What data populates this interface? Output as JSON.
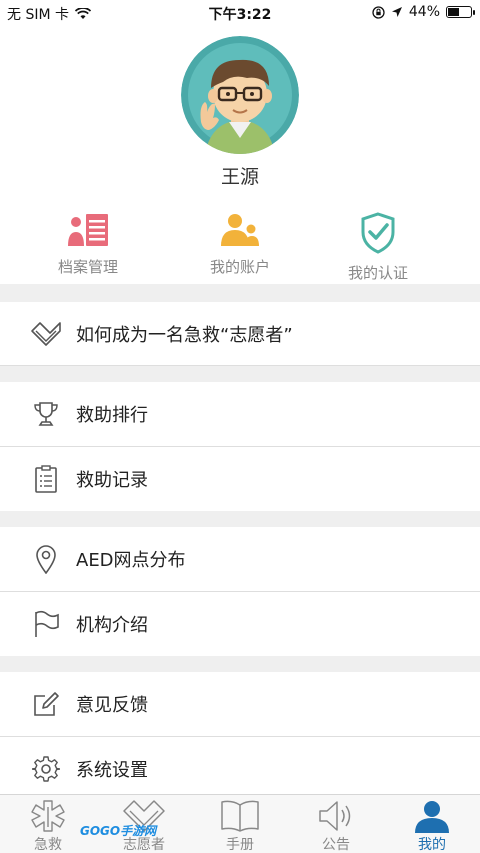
{
  "status": {
    "carrier": "无 SIM 卡",
    "time": "下午3:22",
    "battery_percent": "44%",
    "battery_level": 0.44
  },
  "profile": {
    "name": "王源"
  },
  "quick_actions": [
    {
      "label": "档案管理",
      "icon": "records-icon",
      "color": "#e86b7a"
    },
    {
      "label": "我的账户",
      "icon": "account-icon",
      "color": "#f2b23a"
    },
    {
      "label": "我的认证",
      "icon": "certification-shield-icon",
      "color": "#4bb3a4"
    }
  ],
  "menu": {
    "volunteer": "如何成为一名急救“志愿者”",
    "ranking": "救助排行",
    "records": "救助记录",
    "aed": "AED网点分布",
    "institution": "机构介绍",
    "feedback": "意见反馈",
    "settings": "系统设置"
  },
  "tabs": [
    {
      "label": "急救",
      "icon": "first-aid-icon"
    },
    {
      "label": "志愿者",
      "icon": "volunteer-hands-icon"
    },
    {
      "label": "手册",
      "icon": "book-icon"
    },
    {
      "label": "公告",
      "icon": "speaker-icon"
    },
    {
      "label": "我的",
      "icon": "user-icon",
      "active": true
    }
  ],
  "watermark": "GOGO手游网",
  "colors": {
    "accent": "#1e6fb0",
    "separator": "#efefef"
  }
}
